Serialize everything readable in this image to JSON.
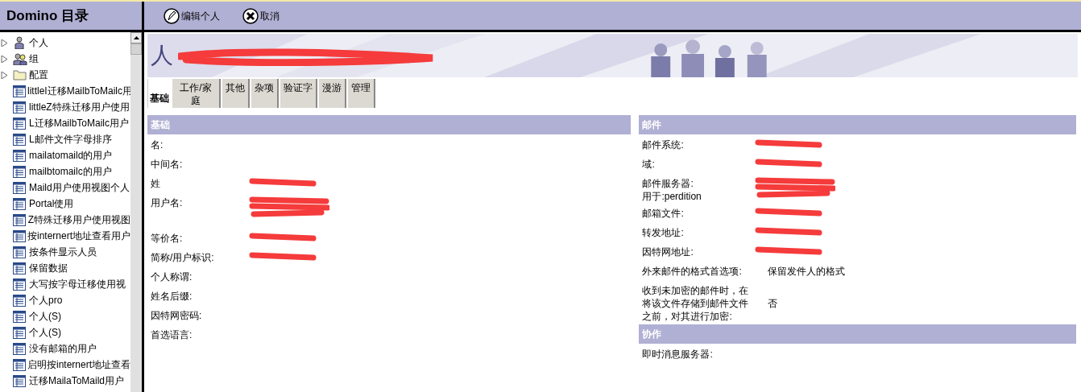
{
  "sidebar": {
    "title": "Domino 目录",
    "items": [
      {
        "kind": "person",
        "label": "个人",
        "expanded": false
      },
      {
        "kind": "group",
        "label": "组",
        "expanded": false
      },
      {
        "kind": "folder",
        "label": "配置",
        "expanded": false
      },
      {
        "kind": "view",
        "label": "littleI迁移MailbToMailc用"
      },
      {
        "kind": "view",
        "label": "littleZ特殊迁移用户使用"
      },
      {
        "kind": "view",
        "label": "L迁移MailbToMailc用户"
      },
      {
        "kind": "view",
        "label": "L邮件文件字母排序"
      },
      {
        "kind": "view",
        "label": "mailatomaild的用户"
      },
      {
        "kind": "view",
        "label": "mailbtomailc的用户"
      },
      {
        "kind": "view",
        "label": "Maild用户使用视图个人"
      },
      {
        "kind": "view",
        "label": "Portal使用"
      },
      {
        "kind": "view",
        "label": "Z特殊迁移用户使用视图"
      },
      {
        "kind": "view",
        "label": "按internert地址查看用户"
      },
      {
        "kind": "view",
        "label": "按条件显示人员"
      },
      {
        "kind": "view",
        "label": "保留数据"
      },
      {
        "kind": "view",
        "label": "大写按字母迁移使用视"
      },
      {
        "kind": "view",
        "label": "个人pro"
      },
      {
        "kind": "view",
        "label": "个人(S)"
      },
      {
        "kind": "view",
        "label": "个人(S)"
      },
      {
        "kind": "view",
        "label": "没有邮箱的用户"
      },
      {
        "kind": "view",
        "label": "启明按internert地址查看"
      },
      {
        "kind": "view",
        "label": "迁移MailaToMaild用户"
      }
    ]
  },
  "toolbar": [
    {
      "kind": "edit",
      "label": "编辑个人"
    },
    {
      "kind": "cancel",
      "label": "取消"
    }
  ],
  "banner": {
    "title": "人",
    "redacted": true
  },
  "tabs": [
    {
      "label": "基础",
      "selected": true
    },
    {
      "label": "工作/家庭",
      "selected": false
    },
    {
      "label": "其他",
      "selected": false
    },
    {
      "label": "杂项",
      "selected": false
    },
    {
      "label": "验证字",
      "selected": false
    },
    {
      "label": "漫游",
      "selected": false
    },
    {
      "label": "管理",
      "selected": false
    }
  ],
  "columns": [
    [
      {
        "title": "基础",
        "fields": [
          {
            "label": "名:",
            "redacted": false
          },
          {
            "label": "中间名:",
            "redacted": false
          },
          {
            "label": "姓",
            "redacted": true
          },
          {
            "label": "用户名:",
            "redacted": true,
            "tall": true
          },
          {
            "label": "等价名:",
            "redacted": true
          },
          {
            "label": "简称/用户标识:",
            "redacted": true
          },
          {
            "label": "个人称谓:",
            "redacted": false
          },
          {
            "label": "姓名后缀:",
            "redacted": false
          },
          {
            "label": "因特网密码:",
            "redacted": false
          },
          {
            "label": "首选语言:",
            "redacted": false
          }
        ]
      }
    ],
    [
      {
        "title": "邮件",
        "fields": [
          {
            "label": "邮件系统:",
            "redacted": true
          },
          {
            "label": "域:",
            "redacted": true
          },
          {
            "label": "邮件服务器:\n用于:perdition",
            "redacted": true
          },
          {
            "label": "邮箱文件:",
            "redacted": true
          },
          {
            "label": "转发地址:",
            "redacted": true
          },
          {
            "label": "因特网地址:",
            "redacted": true
          },
          {
            "label": "外来邮件的格式首选项:",
            "value": "保留发件人的格式",
            "redacted": false
          },
          {
            "label": "收到未加密的邮件时，在将该文件存储到邮件文件之前，对其进行加密:",
            "value": "否",
            "redacted": false
          }
        ]
      },
      {
        "title": "协作",
        "fields": [
          {
            "label": "即时消息服务器:",
            "redacted": false
          }
        ]
      }
    ]
  ]
}
